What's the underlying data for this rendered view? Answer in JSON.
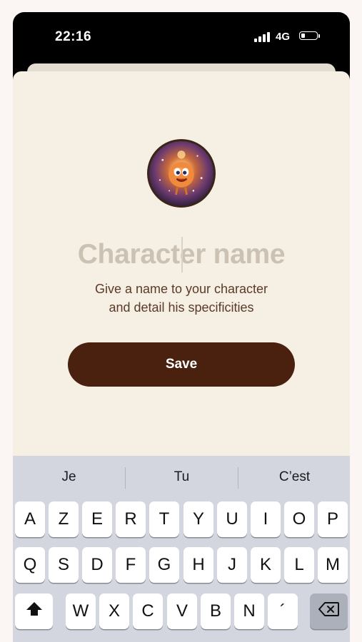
{
  "status_bar": {
    "time": "22:16",
    "network": "4G",
    "icons": [
      "signal-bars-icon",
      "battery-icon"
    ]
  },
  "character": {
    "avatar_icon": "character-avatar-icon",
    "name_placeholder": "Character name",
    "subtitle_line1": "Give a name to your character",
    "subtitle_line2": "and detail his specificities",
    "save_label": "Save"
  },
  "colors": {
    "sheet_background": "#f6f0e4",
    "save_button": "#4a200e",
    "placeholder_text": "#cbc2b4",
    "subtitle_text": "#5a3a26",
    "keyboard_background": "#d3d6de"
  },
  "keyboard": {
    "suggestions": [
      "Je",
      "Tu",
      "C’est"
    ],
    "row1": [
      "A",
      "Z",
      "E",
      "R",
      "T",
      "Y",
      "U",
      "I",
      "O",
      "P"
    ],
    "row2": [
      "Q",
      "S",
      "D",
      "F",
      "G",
      "H",
      "J",
      "K",
      "L",
      "M"
    ],
    "row3": [
      "W",
      "X",
      "C",
      "V",
      "B",
      "N",
      "´"
    ],
    "shift_icon": "shift-icon",
    "backspace_icon": "backspace-icon"
  }
}
